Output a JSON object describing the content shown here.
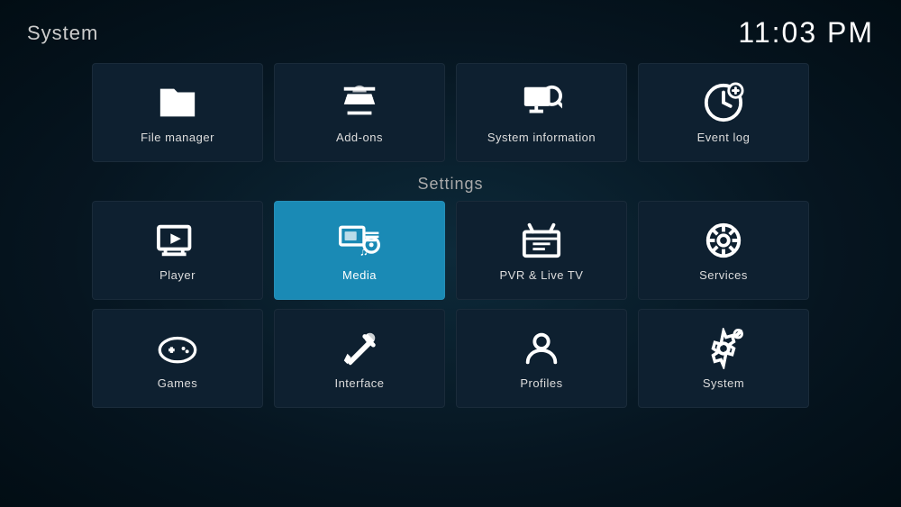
{
  "appTitle": "System",
  "clock": "11:03 PM",
  "topItems": [
    {
      "id": "file-manager",
      "label": "File manager",
      "icon": "folder"
    },
    {
      "id": "add-ons",
      "label": "Add-ons",
      "icon": "addons"
    },
    {
      "id": "system-information",
      "label": "System information",
      "icon": "sysinfo"
    },
    {
      "id": "event-log",
      "label": "Event log",
      "icon": "eventlog"
    }
  ],
  "settingsLabel": "Settings",
  "settingsRows": [
    [
      {
        "id": "player",
        "label": "Player",
        "icon": "player",
        "active": false
      },
      {
        "id": "media",
        "label": "Media",
        "icon": "media",
        "active": true
      },
      {
        "id": "pvr-live-tv",
        "label": "PVR & Live TV",
        "icon": "pvr",
        "active": false
      },
      {
        "id": "services",
        "label": "Services",
        "icon": "services",
        "active": false
      }
    ],
    [
      {
        "id": "games",
        "label": "Games",
        "icon": "games",
        "active": false
      },
      {
        "id": "interface",
        "label": "Interface",
        "icon": "interface",
        "active": false
      },
      {
        "id": "profiles",
        "label": "Profiles",
        "icon": "profiles",
        "active": false
      },
      {
        "id": "system",
        "label": "System",
        "icon": "systemsettings",
        "active": false
      }
    ]
  ]
}
